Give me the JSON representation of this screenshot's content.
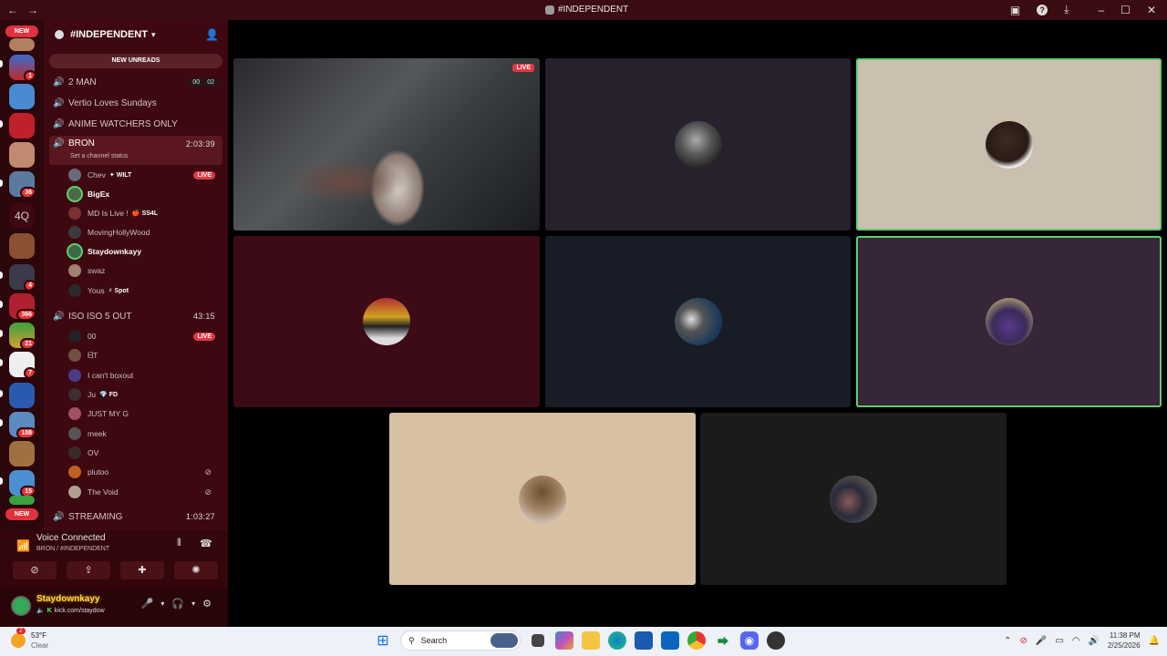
{
  "window": {
    "title": "#INDEPENDENT",
    "back_icon": "←",
    "forward_icon": "→"
  },
  "server_rail": {
    "new_label_top": "NEW",
    "new_label_bottom": "NEW",
    "text_server_label": "4Q",
    "badges": {
      "s1": "1",
      "s2": "36",
      "s3": "4",
      "s4": "366",
      "s5": "21",
      "s6": "7",
      "s7": "108",
      "s8": "15"
    }
  },
  "server": {
    "name": "#INDEPENDENT",
    "new_unreads": "NEW UNREADS"
  },
  "channels": [
    {
      "name": "2 MAN",
      "tags": [
        "00",
        "02"
      ]
    },
    {
      "name": "Vertio Loves Sundays"
    },
    {
      "name": "ANIME WATCHERS ONLY"
    },
    {
      "name": "BRON",
      "time": "2:03:39",
      "status": "Set a channel status"
    },
    {
      "name": "ISO ISO 5 OUT",
      "time": "43:15"
    },
    {
      "name": "STREAMING",
      "time": "1:03:27"
    }
  ],
  "bron_members": [
    {
      "name": "Chev",
      "tag": "WILT",
      "live": "LIVE",
      "color": "#6a6a7a"
    },
    {
      "name": "BigEx",
      "bold": true,
      "color": "#4a6a4a"
    },
    {
      "name": "MD Is Live !",
      "tag": "SS4L",
      "color": "#7a3030"
    },
    {
      "name": "MovingHollyWood",
      "color": "#3a3a3a"
    },
    {
      "name": "Staydownkayy",
      "bold": true,
      "color": "#3a6a4a"
    },
    {
      "name": "swaz",
      "color": "#a08070"
    },
    {
      "name": "Yous",
      "tag": "Spot",
      "color": "#2a2a2a"
    }
  ],
  "iso_members": [
    {
      "name": "00",
      "live": "LIVE",
      "color": "#222"
    },
    {
      "name": "ᗺT",
      "color": "#705040"
    },
    {
      "name": "I can't boxout",
      "color": "#4a3a8a"
    },
    {
      "name": "Ju",
      "tag": "FD",
      "color": "#3a3030"
    },
    {
      "name": "JUST MY G",
      "color": "#a05060"
    },
    {
      "name": "meek",
      "color": "#555"
    },
    {
      "name": "OV",
      "color": "#3a2a2a"
    },
    {
      "name": "plutoo",
      "muted": true,
      "color": "#c06020"
    },
    {
      "name": "The Void",
      "muted": true,
      "color": "#b0a090"
    }
  ],
  "voice": {
    "title": "Voice Connected",
    "subtitle": "BRON / #INDEPENDENT"
  },
  "user": {
    "name": "Staydownkayy",
    "status": "kick.com/staydow"
  },
  "video_grid": {
    "live_label": "LIVE"
  },
  "taskbar": {
    "temp": "53°F",
    "condition": "Clear",
    "weather_badge": "2",
    "search_label": "Search",
    "time": "11:38 PM",
    "date": "2/25/2026"
  }
}
